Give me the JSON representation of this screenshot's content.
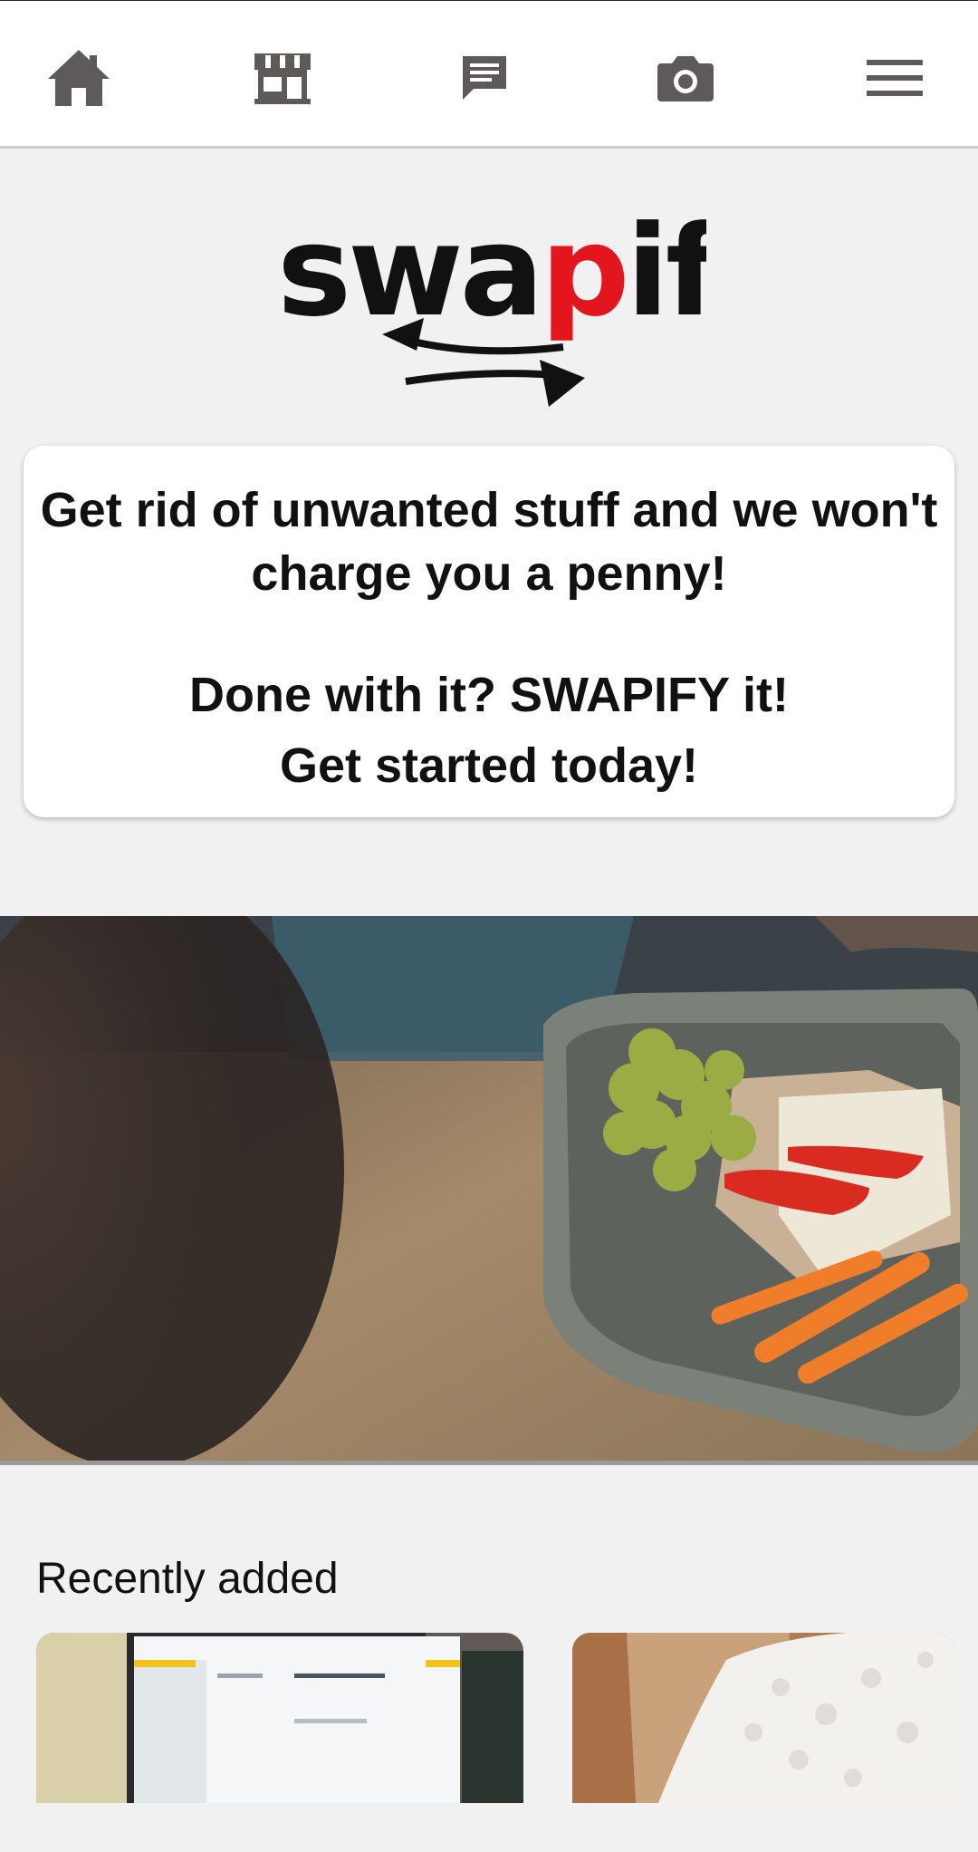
{
  "nav": {
    "icons": [
      "home-icon",
      "storefront-icon",
      "chat-icon",
      "camera-icon",
      "menu-icon"
    ],
    "icon_color": "#5f5a5a"
  },
  "brand": {
    "name": "swapify",
    "accent_letter_color": "#e3151d"
  },
  "promo": {
    "line1": "Get rid of unwanted stuff and we won't charge you a penny!",
    "line2": "Done with it? SWAPIFY it!",
    "line3": "Get started today!"
  },
  "hero": {
    "media": "video-lunchbox"
  },
  "recent": {
    "title": "Recently added",
    "items": [
      {
        "image": "laptop-screen-thumbnail"
      },
      {
        "image": "sherpa-fleece-thumbnail"
      }
    ]
  }
}
